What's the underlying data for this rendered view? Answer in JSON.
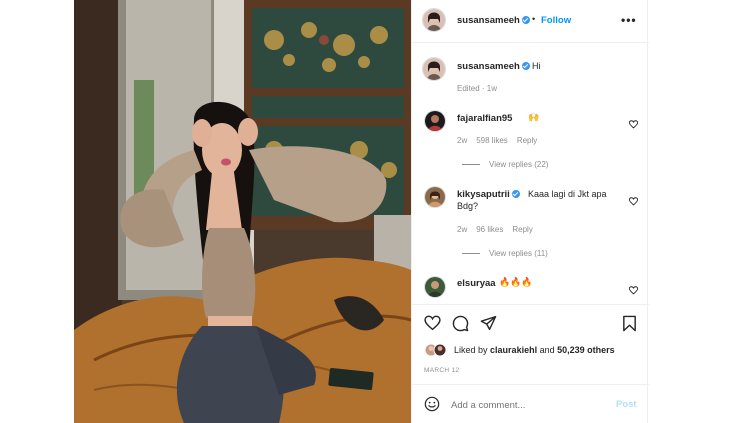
{
  "post": {
    "author": "susansameeh",
    "follow_label": "Follow",
    "more_label": "•••",
    "caption_user": "susansameeh",
    "caption_text": "Hi",
    "caption_meta": "Edited · 1w"
  },
  "comments": [
    {
      "user": "fajaralfian95",
      "verified": false,
      "text": "",
      "emoji": "🙌",
      "age": "2w",
      "likes": "598 likes",
      "reply": "Reply",
      "view_replies": "View replies (22)"
    },
    {
      "user": "kikysaputrii",
      "verified": true,
      "text": "Kaaa lagi di Jkt apa Bdg?",
      "age": "2w",
      "likes": "96 likes",
      "reply": "Reply",
      "view_replies": "View replies (11)"
    },
    {
      "user": "elsuryaa",
      "verified": false,
      "text": "",
      "emoji": "🔥🔥🔥"
    }
  ],
  "engagement": {
    "liked_by_prefix": "Liked by",
    "liked_by_user": "claurakiehl",
    "and": "and",
    "others": "50,239 others",
    "date": "MARCH 12"
  },
  "composer": {
    "placeholder": "Add a comment...",
    "post_label": "Post"
  },
  "colors": {
    "accent": "#0095f6",
    "verified": "#3897f0",
    "muted": "#8e8e8e",
    "text": "#262626"
  },
  "icons": [
    "heart-icon",
    "comment-icon",
    "share-icon",
    "bookmark-icon",
    "smiley-icon",
    "chevron-right-icon",
    "verified-badge-icon"
  ]
}
